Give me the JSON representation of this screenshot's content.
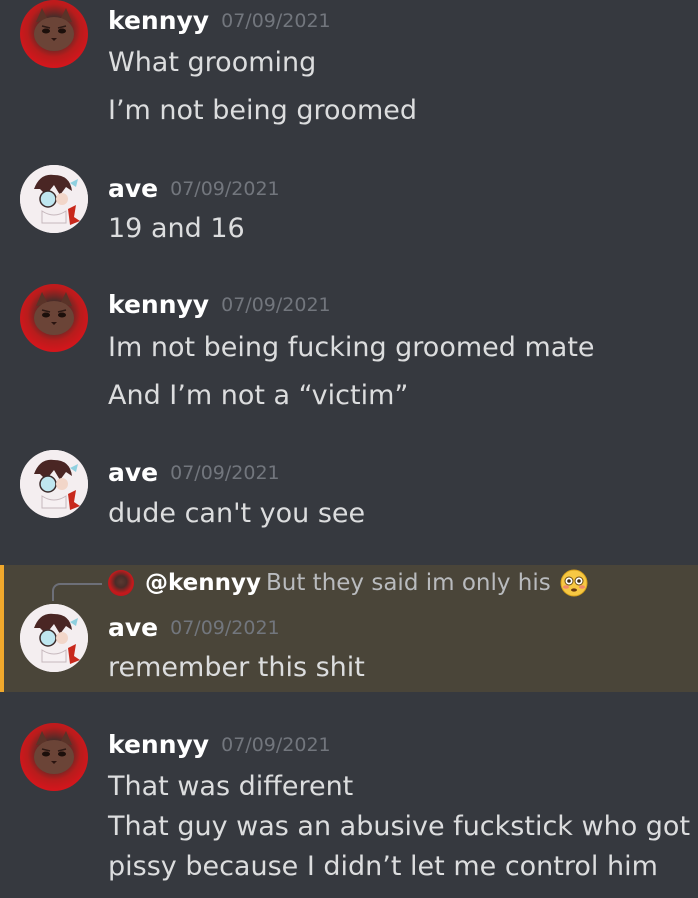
{
  "messages": [
    {
      "author": "kennyy",
      "timestamp": "07/09/2021",
      "avatar_icon": "red-cat-avatar",
      "lines": [
        "What grooming",
        "I’m not being groomed"
      ]
    },
    {
      "author": "ave",
      "timestamp": "07/09/2021",
      "avatar_icon": "anime-character-avatar",
      "lines": [
        "19 and 16"
      ]
    },
    {
      "author": "kennyy",
      "timestamp": "07/09/2021",
      "avatar_icon": "red-cat-avatar",
      "lines": [
        "Im not being fucking groomed mate",
        "And I’m not a “victim”"
      ]
    },
    {
      "author": "ave",
      "timestamp": "07/09/2021",
      "avatar_icon": "anime-character-avatar",
      "lines": [
        "dude can't you see"
      ]
    },
    {
      "author": "ave",
      "timestamp": "07/09/2021",
      "avatar_icon": "anime-character-avatar",
      "highlighted": true,
      "reply": {
        "mention": "@kennyy",
        "text": "But they said im only his",
        "emoji": "flushed-face-emoji"
      },
      "lines": [
        "remember this shit"
      ]
    },
    {
      "author": "kennyy",
      "timestamp": "07/09/2021",
      "avatar_icon": "red-cat-avatar",
      "lines": [
        "That was different",
        "That guy was an abusive fuckstick who got",
        "pissy because I didn’t let me control him"
      ]
    }
  ],
  "colors": {
    "background": "#36393f",
    "highlight_background": "#4a4539",
    "highlight_border": "#f0a82c",
    "username": "#ffffff",
    "timestamp": "#72767d",
    "message_text": "#dcddde"
  }
}
